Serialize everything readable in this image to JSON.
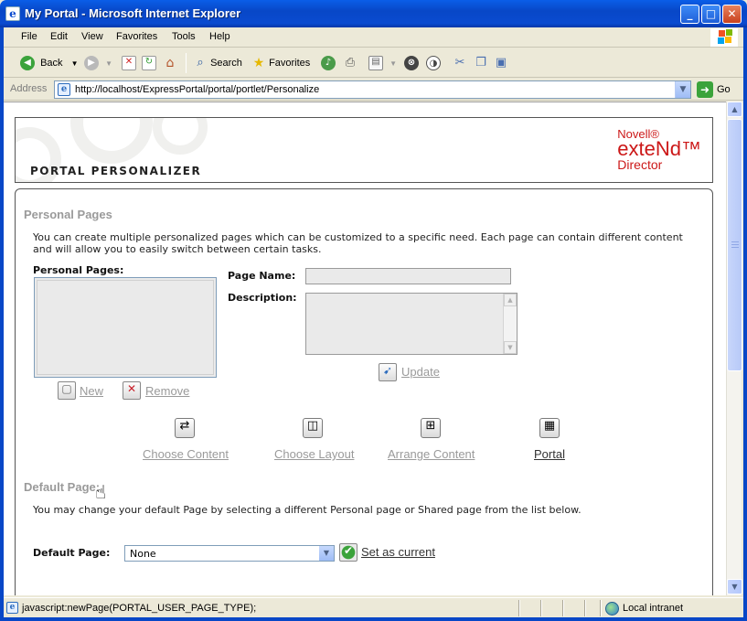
{
  "window": {
    "title": "My Portal - Microsoft Internet Explorer",
    "minimize_glyph": "_",
    "maximize_glyph": "□",
    "close_glyph": "✕"
  },
  "menu": {
    "items": [
      "File",
      "Edit",
      "View",
      "Favorites",
      "Tools",
      "Help"
    ]
  },
  "toolbar": {
    "back_label": "Back",
    "search_label": "Search",
    "favorites_label": "Favorites"
  },
  "address": {
    "label": "Address",
    "url": "http://localhost/ExpressPortal/portal/portlet/Personalize",
    "go_label": "Go"
  },
  "header": {
    "title": "PORTAL PERSONALIZER",
    "brand_line1": "Novell®",
    "brand_line2": "exteNd™",
    "brand_line3": "Director"
  },
  "personal_pages": {
    "section_title": "Personal Pages",
    "description_line1": "You can create multiple personalized pages which can be customized to a specific need. Each page can contain different content",
    "description_line2": "and will allow you to easily switch between certain tasks.",
    "list_label": "Personal Pages:",
    "page_name_label": "Page Name:",
    "page_name_value": "",
    "description_label": "Description:",
    "description_value": "",
    "update_label": "Update",
    "new_label": "New",
    "remove_label": "Remove"
  },
  "actions": {
    "choose_content": "Choose Content",
    "choose_layout": "Choose Layout",
    "arrange_content": "Arrange Content",
    "portal": "Portal"
  },
  "default_page": {
    "section_title": "Default Page:",
    "description": "You may change your default Page by selecting a different Personal page or Shared page from the list below.",
    "label": "Default Page:",
    "selected": "None",
    "set_current_label": "Set as current"
  },
  "status": {
    "text": "javascript:newPage(PORTAL_USER_PAGE_TYPE);",
    "zone": "Local intranet"
  },
  "colors": {
    "brand_red": "#cc1818",
    "title_bar_blue": "#0a4bd0",
    "disabled_gray": "#9a9a9a"
  },
  "icons": {
    "back": "back-arrow-icon",
    "forward": "forward-arrow-icon",
    "stop": "stop-icon",
    "refresh": "refresh-icon",
    "home": "home-icon",
    "search": "search-icon",
    "favorites": "star-icon",
    "media": "media-icon",
    "print": "printer-icon",
    "edit": "edit-page-icon",
    "messenger": "messenger-icon",
    "research": "research-icon",
    "cut": "cut-icon",
    "copy": "copy-icon",
    "paste": "paste-icon"
  }
}
